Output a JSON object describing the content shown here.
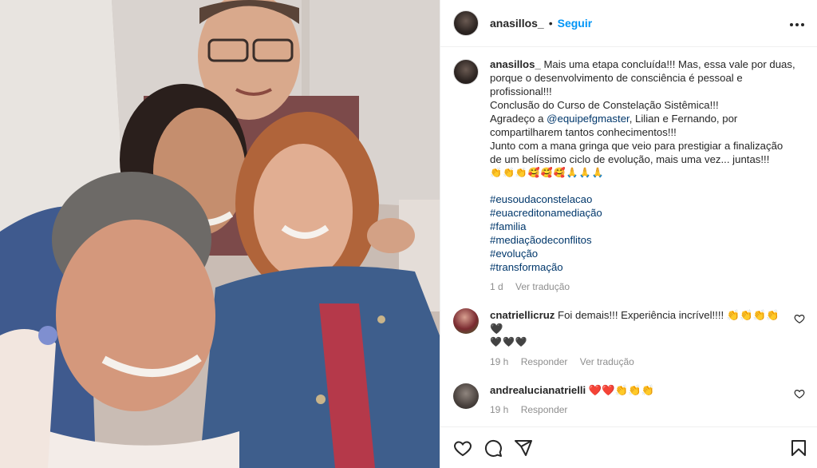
{
  "post": {
    "author": "anasillos_",
    "follow_label": "Seguir",
    "separator": "•",
    "more_label": "•••"
  },
  "caption": {
    "username": "anasillos_",
    "line1": " Mais uma etapa concluída!!! Mas, essa vale por duas,",
    "line2": "porque o desenvolvimento de consciência é pessoal e",
    "line3": "profissional!!!",
    "line4": "Conclusão do Curso de Constelação Sistêmica!!!",
    "line5_pre": "Agradeço a ",
    "mention": "@equipefgmaster",
    "line5_post": ", Lilian e Fernando, por",
    "line6": "compartilharem tantos conhecimentos!!!",
    "line7": "Junto com a mana gringa que veio para prestigiar a finalização",
    "line8": "de um belíssimo ciclo de evolução, mais uma vez... juntas!!!",
    "emojis": "👏👏👏🥰🥰🥰🙏🙏🙏",
    "hashtags": [
      "#eusoudaconstelacao",
      "#euacreditonamediação",
      "#familia",
      "#mediaçãodeconflitos",
      "#evolução",
      "#transformação"
    ],
    "time": "1 d",
    "translate": "Ver tradução"
  },
  "comments": [
    {
      "username": "cnatriellicruz",
      "text": " Foi demais!!! Experiência incrível!!!! 👏👏👏👏🖤",
      "text2": "🖤🖤🖤",
      "time": "19 h",
      "reply": "Responder",
      "translate": "Ver tradução"
    },
    {
      "username": "andrealucianatrielli",
      "text": " ❤️❤️👏👏👏",
      "time": "19 h",
      "reply": "Responder"
    },
    {
      "username": "",
      "text": ""
    }
  ],
  "icons": [
    "heart-icon",
    "comment-icon",
    "share-icon",
    "bookmark-icon",
    "more-options-icon"
  ],
  "colors": {
    "accent": "#0095f6",
    "link": "#00376b",
    "muted": "#8e8e8e",
    "text": "#262626"
  }
}
